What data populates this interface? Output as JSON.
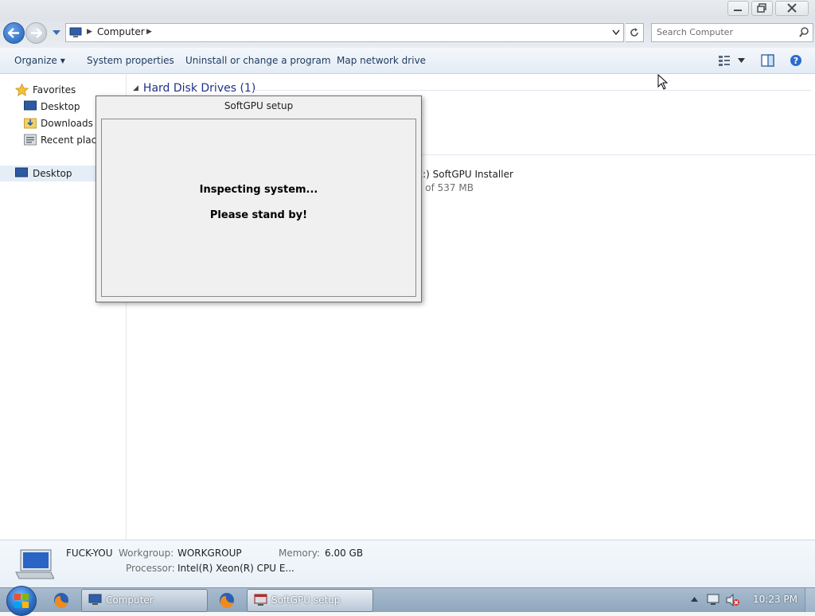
{
  "window": {
    "controls": [
      "minimize-icon",
      "restore-icon",
      "close-icon"
    ]
  },
  "address_bar": {
    "breadcrumb": "Computer",
    "search_placeholder": "Search Computer"
  },
  "toolbar": {
    "organize": "Organize",
    "system_properties": "System properties",
    "uninstall": "Uninstall or change a program",
    "map_drive": "Map network drive"
  },
  "sidebar": {
    "favorites": "Favorites",
    "items": [
      {
        "label": "Desktop",
        "icon": "desktop-icon"
      },
      {
        "label": "Downloads",
        "icon": "downloads-folder-icon"
      },
      {
        "label": "Recent places",
        "icon": "recent-places-icon"
      }
    ],
    "desktop_root": "Desktop"
  },
  "content": {
    "group_header": "Hard Disk Drives (1)",
    "drive_name": ": (E:) SoftGPU Installer",
    "drive_free": "ree of 537 MB"
  },
  "dialog": {
    "title": "SoftGPU setup",
    "line1": "Inspecting system...",
    "line2": "Please stand by!"
  },
  "details": {
    "computer_name": "FUCK-YOU",
    "workgroup_label": "Workgroup:",
    "workgroup_value": "WORKGROUP",
    "memory_label": "Memory:",
    "memory_value": "6.00 GB",
    "processor_label": "Processor:",
    "processor_value": "Intel(R) Xeon(R) CPU E..."
  },
  "taskbar": {
    "buttons": [
      {
        "label": "Computer",
        "icon": "computer-icon"
      },
      {
        "label": "SoftGPU setup",
        "icon": "setup-window-icon"
      }
    ],
    "pinned": [
      "firefox-icon",
      "firefox-icon"
    ],
    "clock": "10:23 PM"
  },
  "colors": {
    "accent": "#1e3287",
    "taskbar": "#9fb3c8",
    "dialog_bg": "#f0f0f0"
  }
}
